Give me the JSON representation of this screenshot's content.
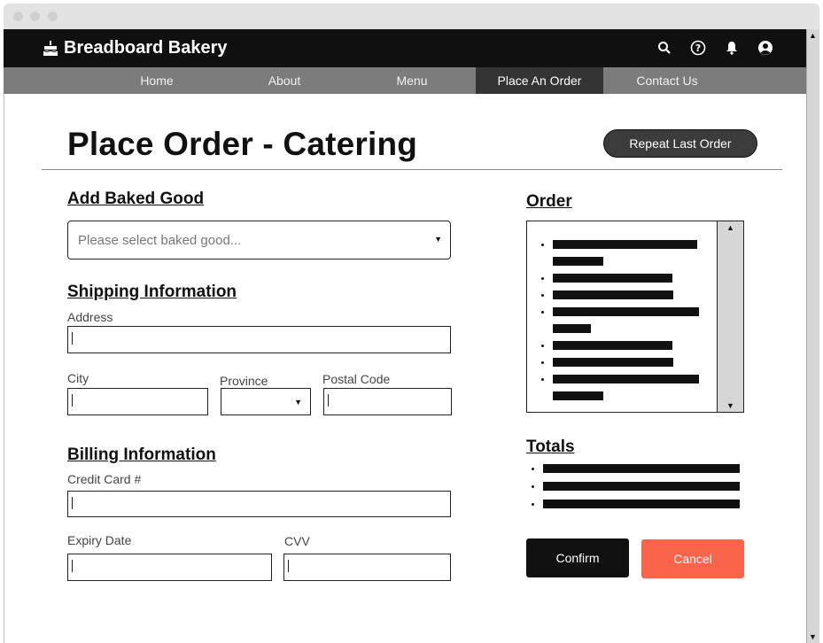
{
  "brand": {
    "name": "Breadboard Bakery",
    "icon": "cake-icon"
  },
  "header_icons": [
    "search-icon",
    "help-icon",
    "bell-icon",
    "user-icon"
  ],
  "nav": {
    "items": [
      {
        "label": "Home"
      },
      {
        "label": "About"
      },
      {
        "label": "Menu"
      },
      {
        "label": "Place An Order",
        "active": true
      },
      {
        "label": "Contact Us"
      }
    ]
  },
  "page": {
    "title": "Place Order - Catering",
    "repeat_button": "Repeat Last Order"
  },
  "baked_good": {
    "heading": "Add Baked Good",
    "placeholder": "Please select baked good..."
  },
  "shipping": {
    "heading": "Shipping Information",
    "address_label": "Address",
    "city_label": "City",
    "province_label": "Province",
    "postal_label": "Postal Code"
  },
  "billing": {
    "heading": "Billing Information",
    "card_label": "Credit Card #",
    "expiry_label": "Expiry Date",
    "cvv_label": "CVV"
  },
  "order": {
    "heading": "Order"
  },
  "totals": {
    "heading": "Totals"
  },
  "actions": {
    "confirm": "Confirm",
    "cancel": "Cancel"
  },
  "colors": {
    "header_bg": "#101010",
    "nav_bg": "#7c7c7c",
    "nav_active_bg": "#343434",
    "cancel_bg": "#f9644a"
  }
}
